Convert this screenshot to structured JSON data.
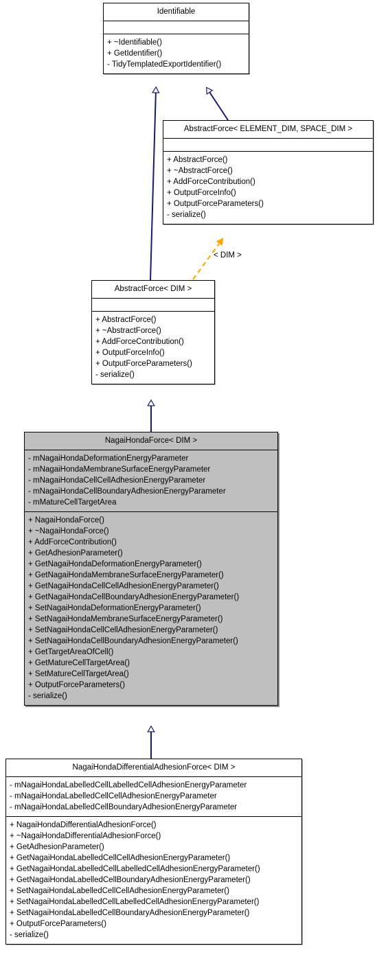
{
  "diagram": {
    "type": "uml-class-inheritance",
    "title": "NagaiHondaDifferentialAdhesionForce class hierarchy",
    "colors": {
      "inheritance_edge": "#191970",
      "template_binding_edge": "#ffa500",
      "highlight_fill": "#bfbfbf",
      "box_fill": "#ffffff",
      "box_border": "#000000"
    },
    "edge_labels": {
      "dim_binding": "< DIM >"
    }
  },
  "classes": {
    "identifiable": {
      "name": "Identifiable",
      "attributes": [],
      "methods": [
        "+ ~Identifiable()",
        "+ GetIdentifier()",
        "- TidyTemplatedExportIdentifier()"
      ]
    },
    "abstract_force_template": {
      "name": "AbstractForce< ELEMENT_DIM, SPACE_DIM >",
      "attributes": [],
      "methods": [
        "+ AbstractForce()",
        "+ ~AbstractForce()",
        "+ AddForceContribution()",
        "+ OutputForceInfo()",
        "+ OutputForceParameters()",
        "- serialize()"
      ]
    },
    "abstract_force_dim": {
      "name": "AbstractForce< DIM >",
      "attributes": [],
      "methods": [
        "+ AbstractForce()",
        "+ ~AbstractForce()",
        "+ AddForceContribution()",
        "+ OutputForceInfo()",
        "+ OutputForceParameters()",
        "- serialize()"
      ]
    },
    "nagai_honda_force": {
      "name": "NagaiHondaForce< DIM >",
      "attributes": [
        "- mNagaiHondaDeformationEnergyParameter",
        "- mNagaiHondaMembraneSurfaceEnergyParameter",
        "- mNagaiHondaCellCellAdhesionEnergyParameter",
        "- mNagaiHondaCellBoundaryAdhesionEnergyParameter",
        "- mMatureCellTargetArea"
      ],
      "methods": [
        "+ NagaiHondaForce()",
        "+ ~NagaiHondaForce()",
        "+ AddForceContribution()",
        "+ GetAdhesionParameter()",
        "+ GetNagaiHondaDeformationEnergyParameter()",
        "+ GetNagaiHondaMembraneSurfaceEnergyParameter()",
        "+ GetNagaiHondaCellCellAdhesionEnergyParameter()",
        "+ GetNagaiHondaCellBoundaryAdhesionEnergyParameter()",
        "+ SetNagaiHondaDeformationEnergyParameter()",
        "+ SetNagaiHondaMembraneSurfaceEnergyParameter()",
        "+ SetNagaiHondaCellCellAdhesionEnergyParameter()",
        "+ SetNagaiHondaCellBoundaryAdhesionEnergyParameter()",
        "+ GetTargetAreaOfCell()",
        "+ GetMatureCellTargetArea()",
        "+ SetMatureCellTargetArea()",
        "+ OutputForceParameters()",
        "- serialize()"
      ]
    },
    "nagai_honda_differential_adhesion_force": {
      "name": "NagaiHondaDifferentialAdhesionForce< DIM >",
      "attributes": [
        "- mNagaiHondaLabelledCellLabelledCellAdhesionEnergyParameter",
        "- mNagaiHondaLabelledCellCellAdhesionEnergyParameter",
        "- mNagaiHondaLabelledCellBoundaryAdhesionEnergyParameter"
      ],
      "methods": [
        "+ NagaiHondaDifferentialAdhesionForce()",
        "+ ~NagaiHondaDifferentialAdhesionForce()",
        "+ GetAdhesionParameter()",
        "+ GetNagaiHondaLabelledCellCellAdhesionEnergyParameter()",
        "+ GetNagaiHondaLabelledCellLabelledCellAdhesionEnergyParameter()",
        "+ GetNagaiHondaLabelledCellBoundaryAdhesionEnergyParameter()",
        "+ SetNagaiHondaLabelledCellCellAdhesionEnergyParameter()",
        "+ SetNagaiHondaLabelledCellLabelledCellAdhesionEnergyParameter()",
        "+ SetNagaiHondaLabelledCellBoundaryAdhesionEnergyParameter()",
        "+ OutputForceParameters()",
        "- serialize()"
      ]
    }
  }
}
